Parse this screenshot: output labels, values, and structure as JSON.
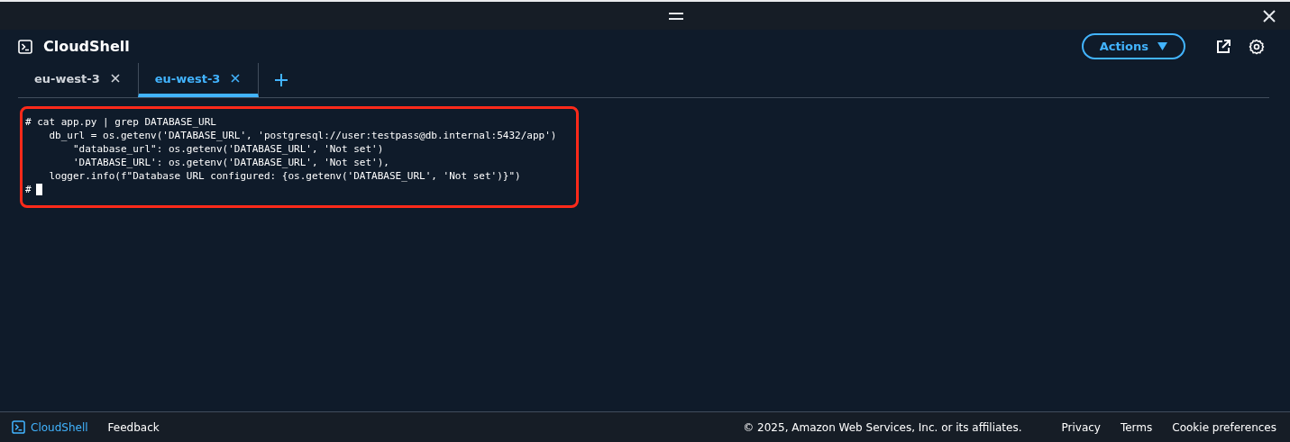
{
  "header": {
    "title": "CloudShell",
    "actions_button": "Actions"
  },
  "tabs": [
    {
      "label": "eu-west-3",
      "selected": false
    },
    {
      "label": "eu-west-3",
      "selected": true
    }
  ],
  "terminal": {
    "lines": [
      "# cat app.py | grep DATABASE_URL",
      "    db_url = os.getenv('DATABASE_URL', 'postgresql://user:testpass@db.internal:5432/app')",
      "        \"database_url\": os.getenv('DATABASE_URL', 'Not set')",
      "        'DATABASE_URL': os.getenv('DATABASE_URL', 'Not set'),",
      "    logger.info(f\"Database URL configured: {os.getenv('DATABASE_URL', 'Not set')}\")"
    ],
    "prompt": "#",
    "highlighted": true
  },
  "footer": {
    "brand": "CloudShell",
    "feedback": "Feedback",
    "copyright": "© 2025, Amazon Web Services, Inc. or its affiliates.",
    "links": [
      "Privacy",
      "Terms",
      "Cookie preferences"
    ]
  }
}
